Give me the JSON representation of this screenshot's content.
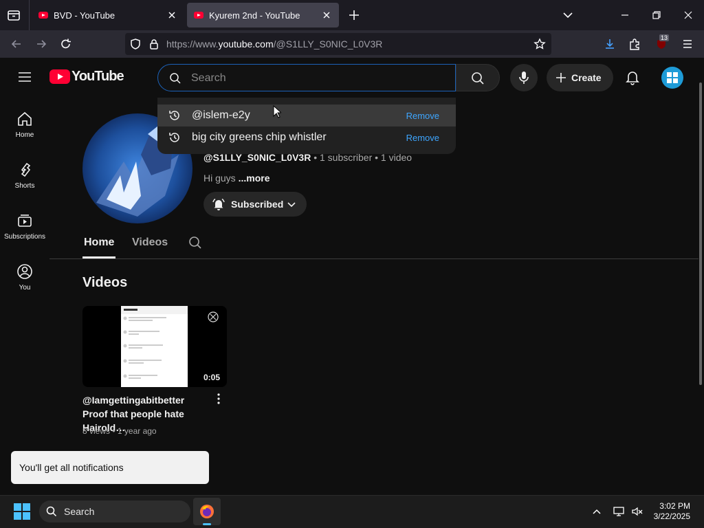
{
  "browser": {
    "tabs": [
      {
        "title": "BVD - YouTube",
        "active": false
      },
      {
        "title": "Kyurem 2nd - YouTube",
        "active": true
      }
    ],
    "url_prefix": "https://www.",
    "url_domain": "youtube.com",
    "url_path": "/@S1LLY_S0NIC_L0V3R",
    "extension_badge": "13"
  },
  "youtube": {
    "logo_text": "YouTube",
    "search_placeholder": "Search",
    "create_label": "Create",
    "suggestions": [
      {
        "text": "@islem-e2y",
        "remove": "Remove"
      },
      {
        "text": "big city greens chip whistler",
        "remove": "Remove"
      }
    ],
    "sidebar": [
      {
        "label": "Home",
        "icon": "home-icon"
      },
      {
        "label": "Shorts",
        "icon": "shorts-icon"
      },
      {
        "label": "Subscriptions",
        "icon": "subscriptions-icon"
      },
      {
        "label": "You",
        "icon": "you-icon"
      }
    ]
  },
  "channel": {
    "handle": "@S1LLY_S0NIC_L0V3R",
    "stats": " • 1 subscriber • 1 video",
    "description": "Hi guys ",
    "more": "...more",
    "subscribed_label": "Subscribed",
    "tabs": [
      "Home",
      "Videos"
    ],
    "section_title": "Videos"
  },
  "video": {
    "title": "@Iamgettingabitbetter Proof that people hate Hairold…",
    "meta": "8 views • 1 year ago",
    "duration": "0:05"
  },
  "toast": "You'll get all notifications",
  "taskbar": {
    "search_label": "Search",
    "time": "3:02 PM",
    "date": "3/22/2025"
  },
  "colors": {
    "youtube_red": "#ff0033",
    "link_blue": "#3ea6ff",
    "focus_blue": "#1c62b9"
  }
}
